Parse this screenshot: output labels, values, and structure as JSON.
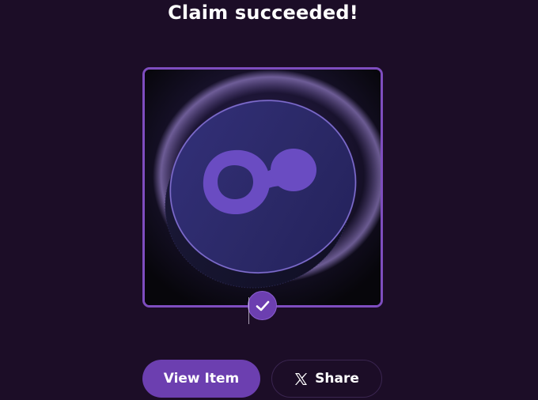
{
  "title": "Claim succeeded!",
  "item": {
    "image_icon": "coin-logo-icon",
    "badge_icon": "checkmark-icon"
  },
  "actions": {
    "view_item_label": "View Item",
    "share_label": "Share",
    "share_icon": "x-logo-icon"
  },
  "colors": {
    "background": "#1c0d27",
    "accent": "#6c3fb0",
    "card_border": "#7e4dbf"
  }
}
